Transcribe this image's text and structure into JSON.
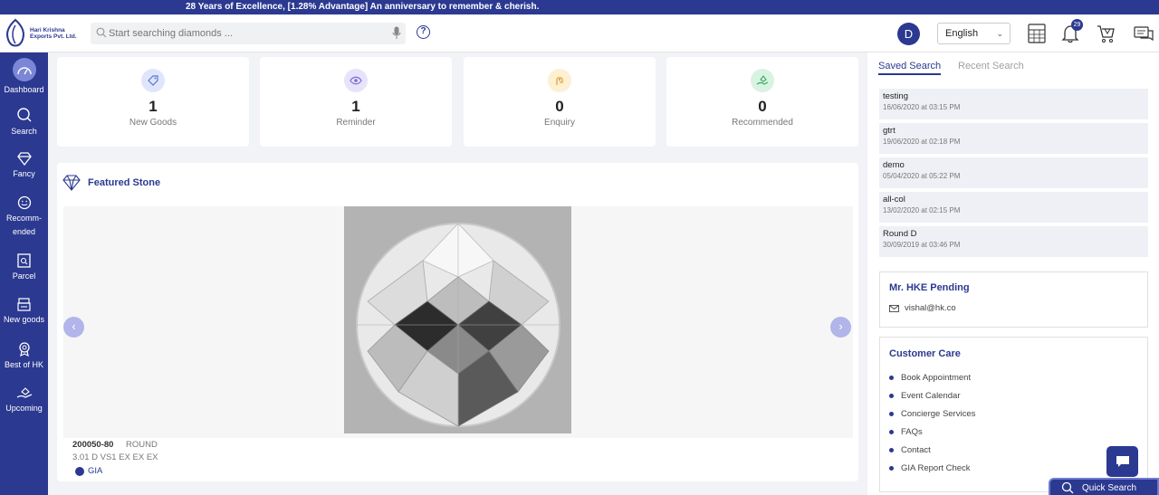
{
  "banner": {
    "text": "28 Years of Excellence, [1.28% Advantage] An anniversary to remember & cherish."
  },
  "header": {
    "logo_text": "Hari Krishna Exports Pvt. Ltd.",
    "search_placeholder": "Start searching diamonds ...",
    "help_label": "?",
    "avatar_initial": "D",
    "language": "English",
    "notification_count": "29",
    "icons": [
      "calculator-icon",
      "bell-icon",
      "cart-icon",
      "messages-icon"
    ]
  },
  "sidebar": {
    "items": [
      {
        "label": "Dashboard",
        "icon": "dashboard-icon",
        "active": true
      },
      {
        "label": "Search",
        "icon": "search-icon"
      },
      {
        "label": "Fancy",
        "icon": "diamond-icon"
      },
      {
        "label": "Recomm-\nended",
        "icon": "smile-icon"
      },
      {
        "label": "Parcel",
        "icon": "parcel-icon"
      },
      {
        "label": "New goods",
        "icon": "new-goods-icon"
      },
      {
        "label": "Best of HK",
        "icon": "ribbon-icon"
      },
      {
        "label": "Upcoming",
        "icon": "hand-icon"
      }
    ]
  },
  "stats": [
    {
      "value": "1",
      "label": "New Goods",
      "color": "#dfe6fb"
    },
    {
      "value": "1",
      "label": "Reminder",
      "color": "#e6e3fa"
    },
    {
      "value": "0",
      "label": "Enquiry",
      "color": "#fdf0d3"
    },
    {
      "value": "0",
      "label": "Recommended",
      "color": "#d9f3e2"
    }
  ],
  "featured": {
    "title": "Featured Stone",
    "stone_id": "200050-80",
    "shape": "ROUND",
    "description": "3.01 D VS1 EX EX EX",
    "lab": "GIA",
    "prev": "‹",
    "next": "›"
  },
  "right": {
    "tabs": [
      "Saved Search",
      "Recent Search"
    ],
    "saved": [
      {
        "name": "testing",
        "date": "16/06/2020 at 03:15 PM"
      },
      {
        "name": "gtrt",
        "date": "19/06/2020 at 02:18 PM"
      },
      {
        "name": "demo",
        "date": "05/04/2020 at 05:22 PM"
      },
      {
        "name": "all-col",
        "date": "13/02/2020 at 02:15 PM"
      },
      {
        "name": "Round D",
        "date": "30/09/2019 at 03:46 PM"
      }
    ],
    "pending": {
      "title": "Mr. HKE Pending",
      "email": "vishal@hk.co"
    },
    "care": {
      "title": "Customer Care",
      "items": [
        "Book Appointment",
        "Event Calendar",
        "Concierge Services",
        "FAQs",
        "Contact",
        "GIA Report Check"
      ]
    }
  },
  "quick_search": "Quick Search",
  "colors": {
    "brand": "#2b3990",
    "accent": "#7b86d6"
  }
}
